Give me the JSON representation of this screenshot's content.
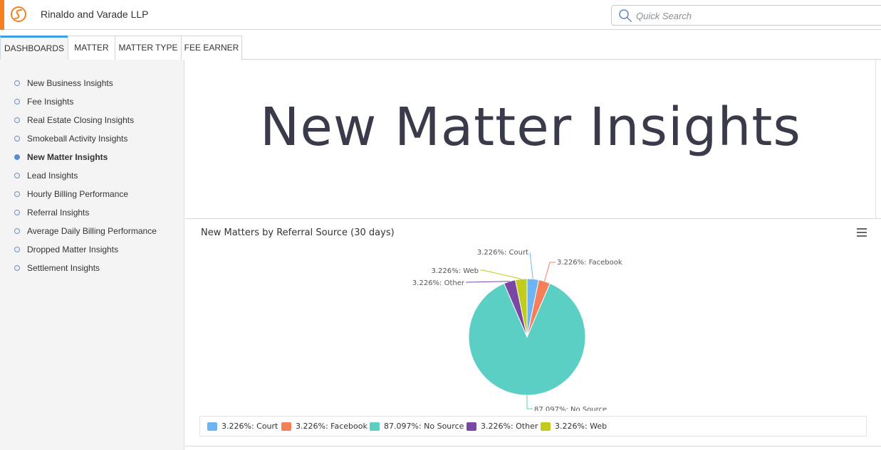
{
  "header": {
    "firm_name": "Rinaldo and Varade LLP",
    "logo_icon": "smokeball-logo-icon",
    "accent_color": "#f4801f",
    "search_placeholder": "Quick Search"
  },
  "tabs": [
    {
      "label": "DASHBOARDS",
      "active": true
    },
    {
      "label": "MATTER",
      "active": false
    },
    {
      "label": "MATTER TYPE",
      "active": false
    },
    {
      "label": "FEE EARNER",
      "active": false
    }
  ],
  "sidebar": {
    "items": [
      {
        "label": "New Business Insights",
        "active": false
      },
      {
        "label": "Fee Insights",
        "active": false
      },
      {
        "label": "Real Estate Closing Insights",
        "active": false
      },
      {
        "label": "Smokeball Activity Insights",
        "active": false
      },
      {
        "label": "New Matter Insights",
        "active": true
      },
      {
        "label": "Lead Insights",
        "active": false
      },
      {
        "label": "Hourly Billing Performance",
        "active": false
      },
      {
        "label": "Referral Insights",
        "active": false
      },
      {
        "label": "Average Daily Billing Performance",
        "active": false
      },
      {
        "label": "Dropped Matter Insights",
        "active": false
      },
      {
        "label": "Settlement Insights",
        "active": false
      }
    ]
  },
  "main": {
    "heading": "New Matter Insights"
  },
  "chart_data": {
    "type": "pie",
    "title": "New Matters by Referral Source (30 days)",
    "slices": [
      {
        "name": "Court",
        "value": 3.226,
        "label": "3.226%: Court",
        "color": "#6cb4f4"
      },
      {
        "name": "Facebook",
        "value": 3.226,
        "label": "3.226%: Facebook",
        "color": "#f57f5b"
      },
      {
        "name": "No Source",
        "value": 87.097,
        "label": "87.097%: No Source",
        "color": "#5ccfc5"
      },
      {
        "name": "Other",
        "value": 3.226,
        "label": "3.226%: Other",
        "color": "#7b47a4"
      },
      {
        "name": "Web",
        "value": 3.226,
        "label": "3.226%: Web",
        "color": "#c2cc1a"
      }
    ],
    "legend": "bottom",
    "legend_items": [
      "3.226%: Court",
      "3.226%: Facebook",
      "87.097%: No Source",
      "3.226%: Other",
      "3.226%: Web"
    ]
  },
  "icons": {
    "search": "search-icon",
    "chart_menu": "hamburger-menu-icon"
  }
}
